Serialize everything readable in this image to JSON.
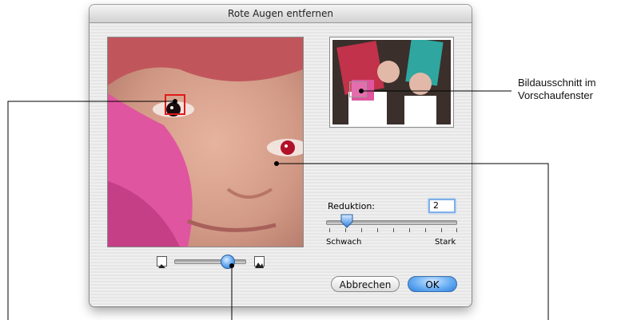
{
  "dialog": {
    "title": "Rote Augen entfernen",
    "reduction_label": "Reduktion:",
    "reduction_value": "2",
    "reduction_level_fraction": 0.12,
    "scale_min_label": "Schwach",
    "scale_max_label": "Stark",
    "zoom_level_fraction": 0.72,
    "cancel_label": "Abbrechen",
    "ok_label": "OK"
  },
  "callouts": {
    "preview_note": "Bildausschnitt im Vorschaufenster"
  },
  "colors": {
    "accent_blue": "#2f7fdc",
    "selection_red": "#e01a1a"
  },
  "icons": {
    "zoom_out": "small-image-icon",
    "zoom_in": "large-image-icon"
  }
}
